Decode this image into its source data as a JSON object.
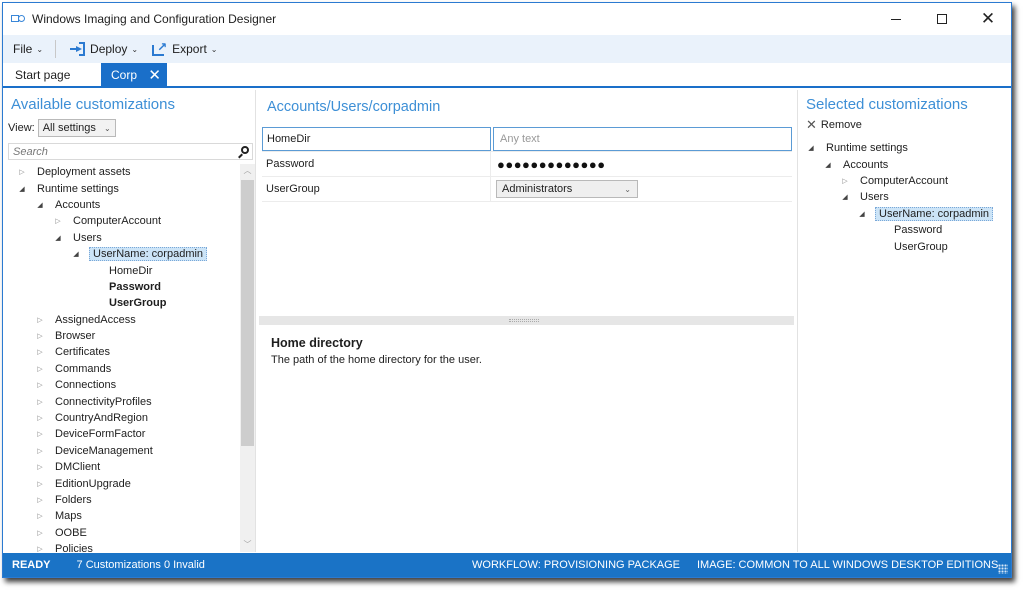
{
  "window": {
    "title": "Windows Imaging and Configuration Designer",
    "controls": {
      "minimize": "minimize",
      "maximize": "maximize",
      "close": "close"
    }
  },
  "toolbar": {
    "file_label": "File",
    "deploy_label": "Deploy",
    "export_label": "Export"
  },
  "tabs": [
    {
      "label": "Start page",
      "active": false
    },
    {
      "label": "Corp",
      "active": true,
      "close": "✕"
    }
  ],
  "left_panel": {
    "title": "Available customizations",
    "view_label": "View:",
    "view_value": "All settings",
    "search_placeholder": "Search",
    "tree": [
      {
        "label": "Deployment assets",
        "level": 0,
        "state": "collapsed"
      },
      {
        "label": "Runtime settings",
        "level": 0,
        "state": "expanded"
      },
      {
        "label": "Accounts",
        "level": 1,
        "state": "expanded"
      },
      {
        "label": "ComputerAccount",
        "level": 2,
        "state": "collapsed"
      },
      {
        "label": "Users",
        "level": 2,
        "state": "expanded"
      },
      {
        "label": "UserName: corpadmin",
        "level": 3,
        "state": "expanded",
        "selected": true
      },
      {
        "label": "HomeDir",
        "level": 4,
        "state": "leaf"
      },
      {
        "label": "Password",
        "level": 4,
        "state": "leaf",
        "bold": true
      },
      {
        "label": "UserGroup",
        "level": 4,
        "state": "leaf",
        "bold": true
      },
      {
        "label": "AssignedAccess",
        "level": 1,
        "state": "collapsed"
      },
      {
        "label": "Browser",
        "level": 1,
        "state": "collapsed"
      },
      {
        "label": "Certificates",
        "level": 1,
        "state": "collapsed"
      },
      {
        "label": "Commands",
        "level": 1,
        "state": "collapsed"
      },
      {
        "label": "Connections",
        "level": 1,
        "state": "collapsed"
      },
      {
        "label": "ConnectivityProfiles",
        "level": 1,
        "state": "collapsed"
      },
      {
        "label": "CountryAndRegion",
        "level": 1,
        "state": "collapsed"
      },
      {
        "label": "DeviceFormFactor",
        "level": 1,
        "state": "collapsed"
      },
      {
        "label": "DeviceManagement",
        "level": 1,
        "state": "collapsed"
      },
      {
        "label": "DMClient",
        "level": 1,
        "state": "collapsed"
      },
      {
        "label": "EditionUpgrade",
        "level": 1,
        "state": "collapsed"
      },
      {
        "label": "Folders",
        "level": 1,
        "state": "collapsed"
      },
      {
        "label": "Maps",
        "level": 1,
        "state": "collapsed"
      },
      {
        "label": "OOBE",
        "level": 1,
        "state": "collapsed"
      },
      {
        "label": "Policies",
        "level": 1,
        "state": "collapsed"
      }
    ]
  },
  "middle_panel": {
    "path_title": "Accounts/Users/corpadmin",
    "settings": [
      {
        "name": "HomeDir",
        "value": "",
        "placeholder": "Any text",
        "type": "text"
      },
      {
        "name": "Password",
        "value": "●●●●●●●●●●●●●",
        "type": "password"
      },
      {
        "name": "UserGroup",
        "value": "Administrators",
        "type": "dropdown"
      }
    ],
    "help": {
      "title": "Home directory",
      "body": "The path of the home directory for the user."
    }
  },
  "right_panel": {
    "title": "Selected customizations",
    "remove_label": "Remove",
    "tree": [
      {
        "label": "Runtime settings",
        "level": 0,
        "state": "expanded"
      },
      {
        "label": "Accounts",
        "level": 1,
        "state": "expanded"
      },
      {
        "label": "ComputerAccount",
        "level": 2,
        "state": "collapsed"
      },
      {
        "label": "Users",
        "level": 2,
        "state": "expanded"
      },
      {
        "label": "UserName: corpadmin",
        "level": 3,
        "state": "expanded",
        "selected": true
      },
      {
        "label": "Password",
        "level": 4,
        "state": "leaf"
      },
      {
        "label": "UserGroup",
        "level": 4,
        "state": "leaf"
      }
    ]
  },
  "statusbar": {
    "status": "READY",
    "counts": "7 Customizations 0 Invalid",
    "workflow": "WORKFLOW: PROVISIONING PACKAGE",
    "image": "IMAGE: COMMON TO ALL WINDOWS DESKTOP EDITIONS"
  },
  "colors": {
    "accent": "#1a6fc9",
    "panel_title": "#3d8fd6",
    "statusbar": "#1a73c6",
    "toolbar_bg": "#eaf2fb",
    "selection": "#cce4f7"
  }
}
